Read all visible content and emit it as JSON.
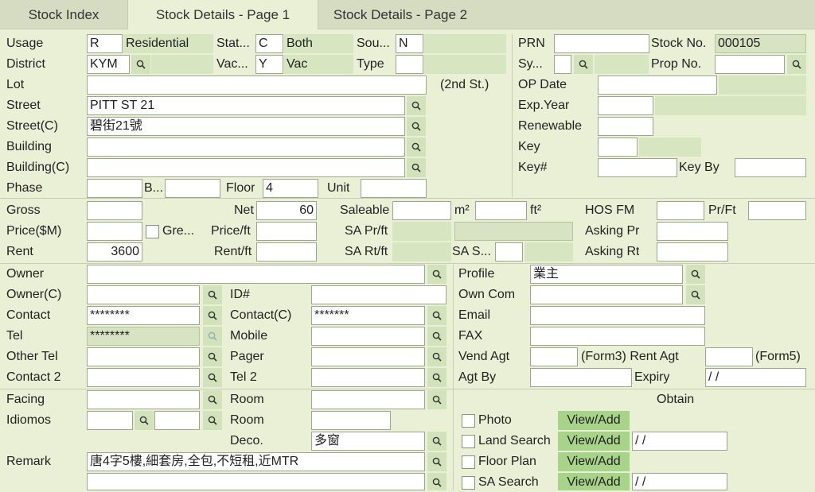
{
  "tabs": [
    {
      "label": "Stock Index"
    },
    {
      "label": "Stock Details - Page 1"
    },
    {
      "label": "Stock Details - Page 2"
    }
  ],
  "labels": {
    "usage": "Usage",
    "district": "District",
    "lot": "Lot",
    "street": "Street",
    "street_c": "Street(C)",
    "building": "Building",
    "building_c": "Building(C)",
    "phase": "Phase",
    "block": "B...",
    "floor": "Floor",
    "unit": "Unit",
    "status": "Stat...",
    "vacant": "Vac...",
    "source": "Sou...",
    "type": "Type",
    "second_st": "(2nd St.)",
    "prn": "PRN",
    "stock_no": "Stock No.",
    "sy": "Sy...",
    "prop_no": "Prop No.",
    "op_date": "OP Date",
    "exp_year": "Exp.Year",
    "renewable": "Renewable",
    "key": "Key",
    "key_num": "Key#",
    "key_by": "Key By",
    "gross": "Gross",
    "net": "Net",
    "saleable": "Saleable",
    "m2": "m²",
    "ft2": "ft²",
    "hos_fm": "HOS FM",
    "pr_ft": "Pr/Ft",
    "price": "Price($M)",
    "gre": "Gre...",
    "price_ft": "Price/ft",
    "sa_pr_ft": "SA Pr/ft",
    "asking_pr": "Asking Pr",
    "rent": "Rent",
    "rent_ft": "Rent/ft",
    "sa_rt_ft": "SA Rt/ft",
    "sa_s": "SA S...",
    "asking_rt": "Asking Rt",
    "owner": "Owner",
    "owner_c": "Owner(C)",
    "id_num": "ID#",
    "contact": "Contact",
    "contact_c": "Contact(C)",
    "tel": "Tel",
    "mobile": "Mobile",
    "other_tel": "Other Tel",
    "pager": "Pager",
    "contact2": "Contact 2",
    "tel2": "Tel 2",
    "profile": "Profile",
    "own_com": "Own Com",
    "email": "Email",
    "fax": "FAX",
    "vend_agt": "Vend Agt",
    "form3_rent_agt": "(Form3) Rent Agt",
    "form5": "(Form5)",
    "agt_by": "Agt By",
    "expiry": "Expiry",
    "facing": "Facing",
    "room": "Room",
    "idiomos": "Idiomos",
    "room2": "Room",
    "deco": "Deco.",
    "remark": "Remark",
    "obtain": "Obtain",
    "photo": "Photo",
    "land_search": "Land Search",
    "floor_plan": "Floor Plan",
    "sa_search": "SA Search"
  },
  "values": {
    "usage": "R",
    "usage_desc": "Residential",
    "status": "C",
    "status_desc": "Both",
    "source": "N",
    "district": "KYM",
    "vacant": "Y",
    "vacant_desc": "Vac",
    "type": "",
    "lot": "",
    "street": "PITT ST 21",
    "street_c": "碧街21號",
    "building": "",
    "building_c": "",
    "phase": "",
    "block": "",
    "floor": "4",
    "unit": "",
    "prn": "",
    "stock_no": "000105",
    "sy": "",
    "prop_no": "",
    "op_date": "",
    "exp_year": "",
    "renewable": "",
    "key": "",
    "key_num": "",
    "key_by": "",
    "gross": "",
    "net": "60",
    "saleable": "",
    "m2": "",
    "hos_fm": "",
    "pr_ft": "",
    "price": "",
    "price_ft": "",
    "asking_pr": "",
    "rent": "3600",
    "rent_ft": "",
    "sa_s": "",
    "asking_rt": "",
    "owner": "",
    "owner_c": "",
    "id_num": "",
    "contact": "********",
    "contact_c": "*******",
    "tel": "********",
    "mobile": "",
    "other_tel": "",
    "pager": "",
    "contact2": "",
    "tel2": "",
    "profile": "業主",
    "own_com": "",
    "email": "",
    "fax": "",
    "vend_agt": "",
    "rent_agt": "",
    "agt_by": "",
    "expiry": "/ /",
    "facing": "",
    "room": "",
    "idiomos_a": "",
    "idiomos_b": "",
    "room2": "",
    "deco": "多窗",
    "remark": "唐4字5樓,細套房,全包,不短租,近MTR",
    "remark2": "",
    "land_search_date": "/ /",
    "sa_search_date": "/ /"
  },
  "buttons": {
    "view_add": "View/Add"
  },
  "colors": {
    "background": "#eaf0d6",
    "readonly": "#d7e6c1",
    "button": "#a8d48a"
  }
}
